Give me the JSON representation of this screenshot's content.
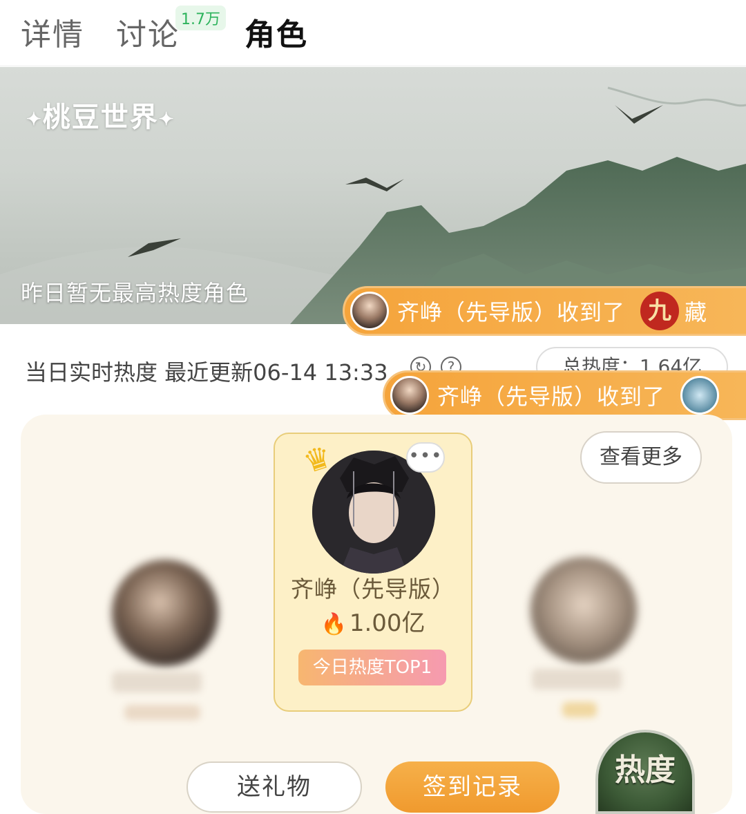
{
  "tabs": [
    {
      "label": "详情"
    },
    {
      "label": "讨论",
      "badge": "1.7万"
    },
    {
      "label": "角色",
      "active": true
    }
  ],
  "banner": {
    "logo": "桃豆世界",
    "caption": "昨日暂无最高热度角色"
  },
  "notifications": [
    {
      "text": "齐峥（先导版）收到了",
      "gift_char": "九",
      "tail": "藏"
    },
    {
      "text": "齐峥（先导版）收到了"
    }
  ],
  "stats": {
    "label": "当日实时热度 最近更新06-14 13:33",
    "refresh_icon": "refresh-icon",
    "help_icon": "help-icon",
    "help_glyph": "?",
    "total": "总热度：1.64亿"
  },
  "ranking": {
    "more": "查看更多",
    "top1": {
      "name": "齐峥（先导版）",
      "score": "1.00亿",
      "tag": "今日热度TOP1",
      "bubble": "•••"
    }
  },
  "actions": {
    "gift": "送礼物",
    "checkin": "签到记录"
  },
  "heat_badge": "热度",
  "colors": {
    "accent_orange": "#f09a2e",
    "badge_green": "#2db35c",
    "top1_bg": "#fdf0c7"
  }
}
